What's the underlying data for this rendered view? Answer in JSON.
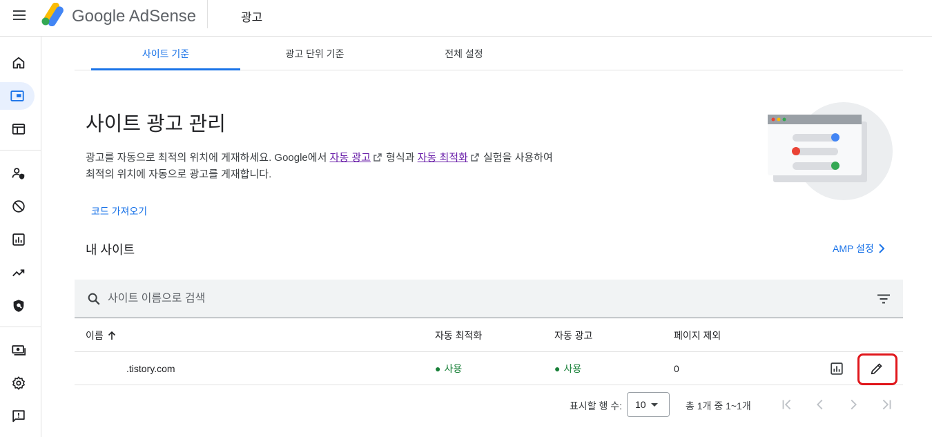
{
  "header": {
    "brand_google": "Google",
    "brand_product": "AdSense",
    "page_name": "광고"
  },
  "rail": [
    {
      "icon": "home-icon"
    },
    {
      "icon": "ads-icon",
      "active": true
    },
    {
      "icon": "web-layout-icon"
    },
    {
      "icon": "account-shield-icon"
    },
    {
      "icon": "block-icon"
    },
    {
      "icon": "reports-icon"
    },
    {
      "icon": "trending-icon"
    },
    {
      "icon": "privacy-shield-icon"
    },
    {
      "icon": "payments-icon"
    },
    {
      "icon": "settings-icon"
    },
    {
      "icon": "feedback-icon"
    }
  ],
  "tabs": [
    {
      "label": "사이트 기준",
      "active": true
    },
    {
      "label": "광고 단위 기준"
    },
    {
      "label": "전체 설정"
    }
  ],
  "intro": {
    "title": "사이트 광고 관리",
    "desc_part1": "광고를 자동으로 최적의 위치에 게재하세요. Google에서 ",
    "link1": "자동 광고",
    "desc_part2": " 형식과 ",
    "link2": "자동 최적화",
    "desc_part3": " 실험을 사용하여",
    "desc_line2": "최적의 위치에 자동으로 광고를 게재합니다.",
    "get_code": "코드 가져오기"
  },
  "sites": {
    "heading": "내 사이트",
    "amp_link": "AMP 설정",
    "search_placeholder": "사이트 이름으로 검색",
    "columns": [
      "이름",
      "자동 최적화",
      "자동 광고",
      "페이지 제외"
    ],
    "rows": [
      {
        "name": ".tistory.com",
        "auto_optimize": "사용",
        "auto_ads": "사용",
        "excluded_pages": "0"
      }
    ]
  },
  "pagination": {
    "rows_label": "표시할 행 수:",
    "rows_value": "10",
    "range": "총 1개 중 1~1개"
  },
  "colors": {
    "accent": "#1a73e8",
    "status_on": "#188038",
    "highlight": "#e0161b",
    "link_visited": "#681da8"
  }
}
